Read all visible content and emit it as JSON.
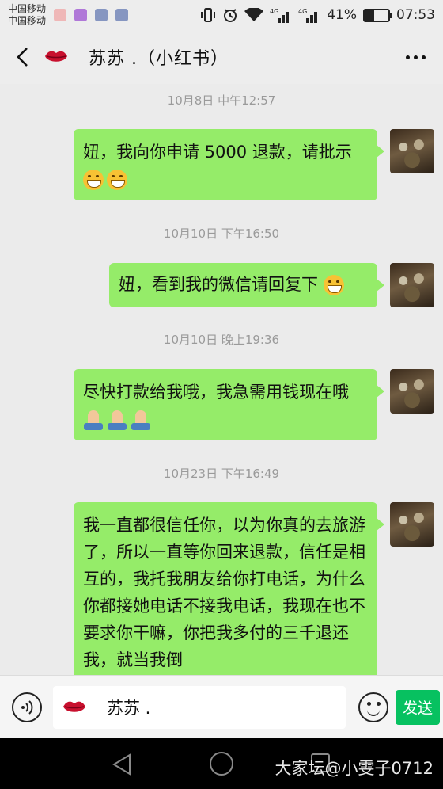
{
  "status_bar": {
    "carrier1": "中国移动",
    "carrier2": "中国移动",
    "signal_label1": "4G",
    "signal_label2": "4G",
    "battery_text": "41%",
    "battery_level": 0.41,
    "time": "07:53"
  },
  "header": {
    "title": "苏苏 .（小红书）"
  },
  "messages": [
    {
      "timestamp": "10月8日 中午12:57",
      "text": "妞，我向你申请 5000 退款，请批示",
      "emojis": [
        "grin",
        "grin"
      ]
    },
    {
      "timestamp": "10月10日 下午16:50",
      "text": "妞，看到我的微信请回复下",
      "emojis": [
        "grin"
      ]
    },
    {
      "timestamp": "10月10日 晚上19:36",
      "text": "尽快打款给我哦，我急需用钱现在哦",
      "emojis": [
        "pray",
        "pray",
        "pray"
      ]
    },
    {
      "timestamp": "10月23日 下午16:49",
      "text": "我一直都很信任你，以为你真的去旅游了，所以一直等你回来退款，信任是相互的，我托我朋友给你打电话，为什么你都接她电话不接我电话，我现在也不要求你干嘛，你把我多付的三千退还我，就当我倒",
      "emojis": []
    }
  ],
  "input_bar": {
    "quoted_name": "苏苏 .",
    "send_label": "发送"
  },
  "watermark": "大家坛@小雯子0712",
  "colors": {
    "bubble": "#95ec69",
    "send_button": "#07c160",
    "background": "#ebebeb"
  }
}
